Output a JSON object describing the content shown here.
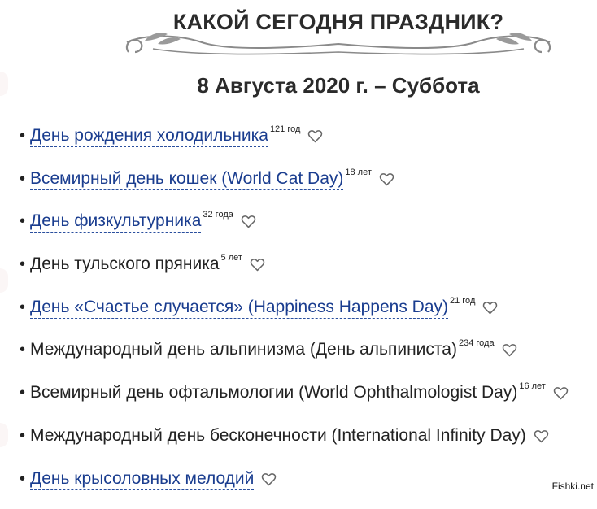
{
  "header": {
    "title": "КАКОЙ СЕГОДНЯ ПРАЗДНИК?",
    "date": "8 Августа 2020 г. – Суббота"
  },
  "holidays": [
    {
      "name": "День рождения холодильника",
      "age": "121 год",
      "linked": true
    },
    {
      "name": "Всемирный день кошек (World Cat Day)",
      "age": "18 лет",
      "linked": true
    },
    {
      "name": "День физкультурника",
      "age": "32 года",
      "linked": true
    },
    {
      "name": "День тульского пряника",
      "age": "5 лет",
      "linked": false
    },
    {
      "name": "День «Счастье случается» (Happiness Happens Day)",
      "age": "21 год",
      "linked": true
    },
    {
      "name": "Международный день альпинизма (День альпиниста)",
      "age": "234 года",
      "linked": false
    },
    {
      "name": "Всемирный день офтальмологии (World Ophthalmologist Day)",
      "age": "16 лет",
      "linked": false
    },
    {
      "name": "Международный день бесконечности (International Infinity Day)",
      "age": "",
      "linked": false
    },
    {
      "name": "День крысоловных мелодий",
      "age": "",
      "linked": true
    }
  ],
  "bullet": "•",
  "watermark": "Fishki.net",
  "colors": {
    "link": "#1a3d8f",
    "text": "#222222",
    "ornament": "#8a8a8a"
  }
}
